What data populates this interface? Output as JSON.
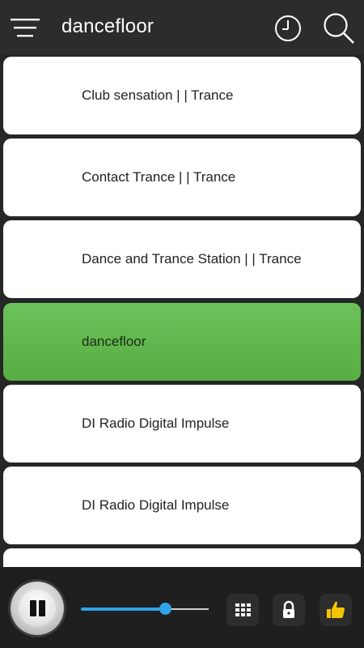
{
  "header": {
    "title": "dancefloor",
    "icons": {
      "menu": "menu-icon",
      "history": "clock-icon",
      "search": "search-icon"
    }
  },
  "stations": [
    {
      "label": "Club sensation | | Trance",
      "active": false
    },
    {
      "label": "Contact Trance | | Trance",
      "active": false
    },
    {
      "label": "Dance and Trance Station | | Trance",
      "active": false
    },
    {
      "label": "dancefloor",
      "active": true
    },
    {
      "label": "DI Radio Digital Impulse",
      "active": false
    },
    {
      "label": "DI Radio Digital Impulse",
      "active": false
    },
    {
      "label": "",
      "active": false
    }
  ],
  "player": {
    "state": "playing",
    "volume": 0.68,
    "icons": {
      "play_pause": "pause-icon",
      "grid": "grid-icon",
      "lock": "lock-icon",
      "like": "thumbs-up-icon"
    }
  },
  "colors": {
    "active_station": "#5fb84b",
    "accent": "#2fa3e8",
    "like": "#f5c400"
  }
}
